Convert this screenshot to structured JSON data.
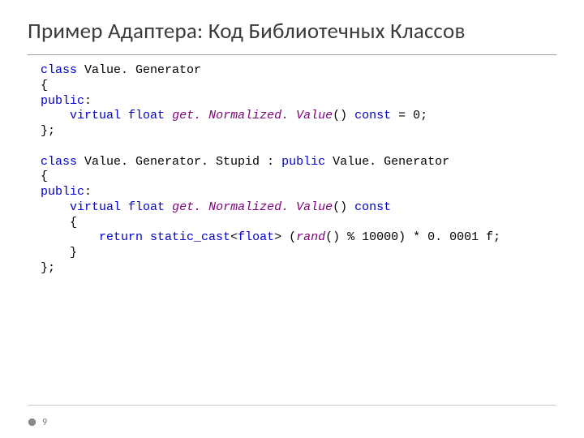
{
  "slide": {
    "title": "Пример Адаптера: Код Библиотечных Классов",
    "page_number": "9"
  },
  "code": {
    "c1": "class",
    "c1b": " Value. Generator",
    "c2": "{",
    "c3": "public",
    "c3b": ":",
    "c4a": "    ",
    "c4b": "virtual",
    "c4c": " ",
    "c4d": "float",
    "c4e": " ",
    "c4f": "get. Normalized. Value",
    "c4g": "() ",
    "c4h": "const",
    "c4i": " = 0;",
    "c5": "};",
    "blank1": "",
    "d1": "class",
    "d1b": " Value. Generator. Stupid : ",
    "d1c": "public",
    "d1d": " Value. Generator",
    "d2": "{",
    "d3": "public",
    "d3b": ":",
    "d4a": "    ",
    "d4b": "virtual",
    "d4c": " ",
    "d4d": "float",
    "d4e": " ",
    "d4f": "get. Normalized. Value",
    "d4g": "() ",
    "d4h": "const",
    "d5": "    {",
    "d6a": "        ",
    "d6b": "return",
    "d6c": " ",
    "d6d": "static_cast",
    "d6e": "<",
    "d6f": "float",
    "d6g": "> (",
    "d6h": "rand",
    "d6i": "() % 10000) * 0. 0001 f;",
    "d7": "    }",
    "d8": "};"
  }
}
